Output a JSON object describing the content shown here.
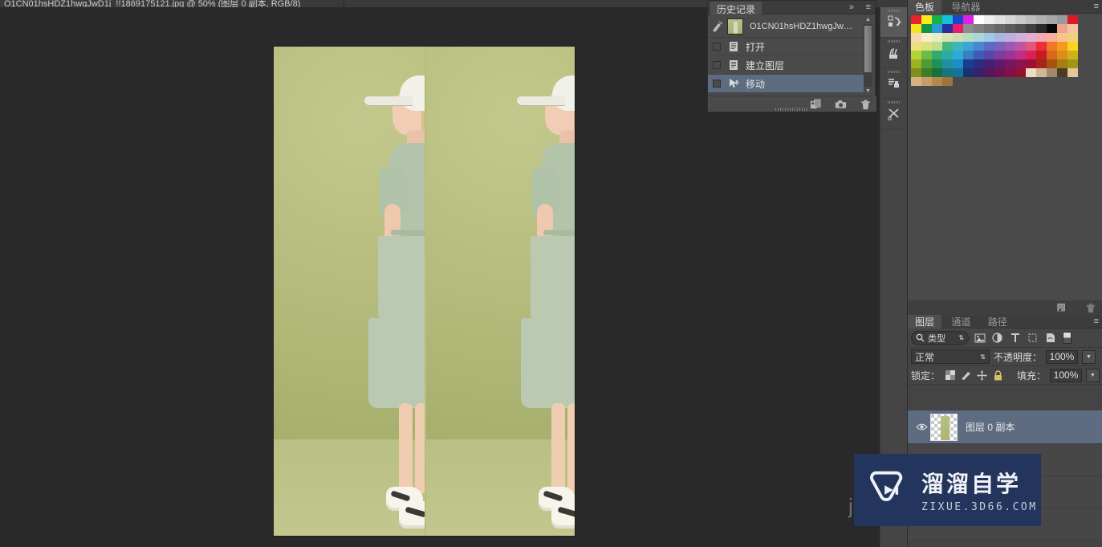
{
  "document": {
    "tab_title": "O1CN01hsHDZ1hwgJwD1j_!!1869175121.jpg @ 50% (图层 0 副本, RGB/8)"
  },
  "history_panel": {
    "tabs": [
      {
        "label": "历史记录",
        "active": true
      }
    ],
    "collapse_icon": "»",
    "menu_icon": "≡",
    "snapshot": {
      "label": "O1CN01hsHDZ1hwgJwD...",
      "brush_icon": "history-brush-icon"
    },
    "items": [
      {
        "label": "打开",
        "icon": "document-icon",
        "selected": false
      },
      {
        "label": "建立图层",
        "icon": "document-icon",
        "selected": false
      },
      {
        "label": "移动",
        "icon": "move-tool-icon",
        "selected": true
      }
    ],
    "footer_buttons": [
      {
        "name": "new-document-from-state-button",
        "icon": "new-doc-icon"
      },
      {
        "name": "new-snapshot-button",
        "icon": "camera-icon"
      },
      {
        "name": "delete-state-button",
        "icon": "trash-icon"
      }
    ]
  },
  "vertical_dock": [
    {
      "name": "dock-actions",
      "icon": "actions-icon",
      "active": true
    },
    {
      "name": "dock-brush",
      "icon": "brush-icon",
      "active": false
    },
    {
      "name": "dock-clone-source",
      "icon": "clone-source-icon",
      "active": false
    },
    {
      "name": "dock-tool-presets",
      "icon": "scissors-tools-icon",
      "active": false
    }
  ],
  "swatches_panel": {
    "tabs": [
      {
        "label": "色板",
        "active": true
      },
      {
        "label": "导航器",
        "active": false
      }
    ],
    "menu_icon": "≡",
    "colors": [
      "#e8222a",
      "#f7ec1f",
      "#19b14b",
      "#16c0d9",
      "#1b48c8",
      "#e020e8",
      "#ffffff",
      "#efefef",
      "#e2e2e2",
      "#d6d6d6",
      "#cacaca",
      "#bebebe",
      "#b2b2b2",
      "#a6a6a6",
      "#9a9a9a",
      "#d81b24",
      "#f4e41c",
      "#0f9448",
      "#2a9bd8",
      "#2b2f9e",
      "#e81b6e",
      "#8d8d8d",
      "#808080",
      "#747474",
      "#686868",
      "#5c5c5c",
      "#505050",
      "#3f3f3f",
      "#2a2a2a",
      "#0a0a0a",
      "#f0a48a",
      "#f6c4a4",
      "#f8d6b4",
      "#faeccb",
      "#e7edc0",
      "#d9e4b1",
      "#cbe0ac",
      "#b8dcbf",
      "#a9d6d7",
      "#9fc9e4",
      "#a8b6e0",
      "#bdb0de",
      "#cfb0dc",
      "#e3aed0",
      "#f0a9b6",
      "#f4b09a",
      "#f6c58e",
      "#f0cf7f",
      "#e9e07e",
      "#d9e37c",
      "#c5dd8c",
      "#47b580",
      "#3eb6c0",
      "#3ea3d6",
      "#4b86cf",
      "#5c6cc6",
      "#7b5fbc",
      "#9b5ab5",
      "#c2549f",
      "#e1567f",
      "#ee2d36",
      "#f07820",
      "#f59a1f",
      "#f7d521",
      "#b5d334",
      "#6cbb44",
      "#2eab6d",
      "#2fa8a8",
      "#2bacd7",
      "#3a7fc4",
      "#3d5cb5",
      "#5a46a8",
      "#7b3fa0",
      "#9d3594",
      "#c22d85",
      "#dc1f58",
      "#c41c22",
      "#d46a1a",
      "#d98f19",
      "#cdb31b",
      "#a0b022",
      "#4f9c36",
      "#1f8f5c",
      "#2090a0",
      "#1e8dc4",
      "#1a3d8f",
      "#2c2c80",
      "#471f72",
      "#5e1a6b",
      "#751661",
      "#8c1352",
      "#9c1038",
      "#a62414",
      "#a75213",
      "#a87c14",
      "#9d9616",
      "#7f8f1c",
      "#3e7c26",
      "#15723f",
      "#16747e",
      "#15729c",
      "#1a3270",
      "#3b1f6a",
      "#55165e",
      "#6e1154",
      "#84104a",
      "#97102f",
      "#f0dcc2",
      "#cfb898",
      "#a08a6a",
      "#4a3b24",
      "#e7c59a",
      "#d8b183",
      "#c79c6a",
      "#b4874f",
      "#a0723c"
    ],
    "footer_buttons": [
      {
        "name": "new-swatch-button",
        "icon": "new-swatch-icon"
      },
      {
        "name": "delete-swatch-button",
        "icon": "trash-icon"
      }
    ]
  },
  "layers_panel": {
    "tabs": [
      {
        "label": "图层",
        "active": true
      },
      {
        "label": "通道",
        "active": false
      },
      {
        "label": "路径",
        "active": false
      }
    ],
    "menu_icon": "≡",
    "filter": {
      "search_icon": "search-icon",
      "kind_label": "类型",
      "stepper_icon": "⇅",
      "kind_buttons": [
        {
          "name": "filter-pixel-layers",
          "icon": "image-icon"
        },
        {
          "name": "filter-adjustment-layers",
          "icon": "adjustment-icon"
        },
        {
          "name": "filter-type-layers",
          "icon": "type-t-icon"
        },
        {
          "name": "filter-shape-layers",
          "icon": "shape-icon"
        },
        {
          "name": "filter-smart-objects",
          "icon": "smart-object-icon"
        }
      ],
      "toggle_name": "filter-enable-toggle"
    },
    "blend": {
      "mode_label": "正常",
      "mode_arrow": "⇅",
      "opacity_label": "不透明度：",
      "opacity_value": "100%",
      "spinner_icon": "▼"
    },
    "lock": {
      "label": "锁定：",
      "buttons": [
        {
          "name": "lock-transparent-pixels",
          "icon": "checker-icon"
        },
        {
          "name": "lock-image-pixels",
          "icon": "brush-icon"
        },
        {
          "name": "lock-position",
          "icon": "move-arrows-icon"
        },
        {
          "name": "lock-all",
          "icon": "lock-icon"
        }
      ],
      "fill_label": "填充：",
      "fill_value": "100%",
      "spinner_icon": "▼"
    },
    "layers": [
      {
        "name": "图层 0 副本",
        "visible": true,
        "visibility_icon": "eye-icon",
        "selected": true
      }
    ]
  },
  "canvas": {
    "zoom_text": "50%",
    "background_color": "#b6bd7e",
    "dress_color": "#b8c5ae",
    "stray_text": "j"
  },
  "watermark": {
    "title": "溜溜自学",
    "url": "ZIXUE.3D66.COM",
    "logo_icon": "play-button-logo",
    "background_color": "#23355c"
  }
}
